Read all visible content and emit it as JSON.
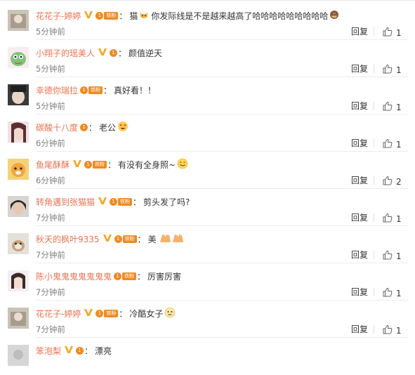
{
  "labels": {
    "reply": "回复",
    "fan_tag": "铁粉"
  },
  "comments": [
    {
      "username": "花花子-婷婷",
      "verified": true,
      "fan_level": "1",
      "fan_tag": true,
      "text": "猫",
      "emoji_after": "cat-face-emoji",
      "text2": "你发际线是不是越来越高了哈哈哈哈哈哈哈哈哈",
      "emoji_end": "see-no-evil-monkey-emoji",
      "time": "5分钟前",
      "likes": "1"
    },
    {
      "username": "小翔子的瑶美人",
      "verified": true,
      "fan_level": "1",
      "fan_tag": false,
      "text": "颜值逆天",
      "time": "5分钟前",
      "likes": "1"
    },
    {
      "username": "幸德你瑞拉",
      "verified": false,
      "fan_level": "1",
      "fan_tag": true,
      "text": "真好看！！",
      "time": "5分钟前",
      "likes": "1"
    },
    {
      "username": "碳酸十八度",
      "verified": false,
      "fan_level": "1",
      "fan_tag": false,
      "text": "老公",
      "emoji_end": "heart-eyes-emoji",
      "time": "6分钟前",
      "likes": "1"
    },
    {
      "username": "鱼尾酥酥",
      "verified": true,
      "fan_level": "1",
      "fan_tag": true,
      "text": "有没有全身照~",
      "emoji_end": "smiling-face-emoji",
      "time": "6分钟前",
      "likes": "2"
    },
    {
      "username": "转角遇到张猫猫",
      "verified": true,
      "fan_level": "1",
      "fan_tag": true,
      "text": "剪头发了吗?",
      "time": "7分钟前",
      "likes": "1"
    },
    {
      "username": "秋天的枫叶9335",
      "verified": true,
      "fan_level": "1",
      "fan_tag": true,
      "text": "美",
      "emoji_end": "clapping-hands-emoji",
      "time": "7分钟前",
      "likes": "1"
    },
    {
      "username": "陈小鬼鬼鬼鬼鬼鬼鬼",
      "verified": false,
      "fan_level": "1",
      "fan_tag": true,
      "text": "厉害厉害",
      "time": "7分钟前",
      "likes": "1"
    },
    {
      "username": "花花子-婷婷",
      "verified": true,
      "fan_level": "1",
      "fan_tag": true,
      "text": "冷酷女子",
      "emoji_end": "cool-face-emoji",
      "time": "7分钟前",
      "likes": "1"
    },
    {
      "username": "笨泡梨",
      "verified": true,
      "fan_level": "1",
      "fan_tag": false,
      "text": "漂亮",
      "time": "",
      "likes": ""
    }
  ]
}
